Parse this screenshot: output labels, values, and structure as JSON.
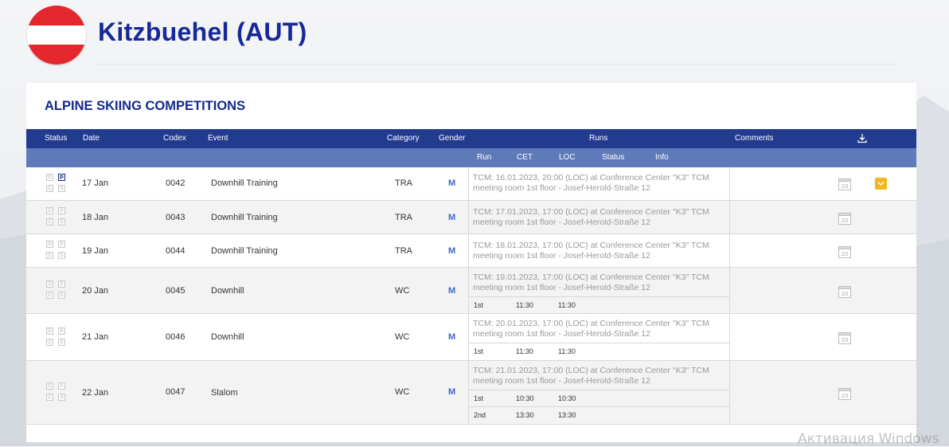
{
  "header": {
    "title": "Kitzbuehel (AUT)",
    "flag_colors": [
      "#e3272d",
      "#ffffff",
      "#e3272d"
    ]
  },
  "panel": {
    "title": "ALPINE SKIING COMPETITIONS"
  },
  "table": {
    "columns": {
      "status": "Status",
      "date": "Date",
      "codex": "Codex",
      "event": "Event",
      "category": "Category",
      "gender": "Gender",
      "runs": "Runs",
      "comments": "Comments"
    },
    "download_icon": "download-icon",
    "runs_subcolumns": {
      "run": "Run",
      "cet": "CET",
      "loc": "LOC",
      "status": "Status",
      "info": "Info"
    },
    "status_letters": [
      "D",
      "P",
      "C",
      "S"
    ],
    "rows": [
      {
        "date": "17 Jan",
        "codex": "0042",
        "event": "Downhill Training",
        "category": "TRA",
        "gender": "M",
        "tcm_line1": "TCM: 16.01.2023, 20:00 (LOC) at Conference Center \"K3\" TCM",
        "tcm_line2": "meeting room 1st floor - Josef-Herold-Straße 12",
        "runs": [],
        "calendar_label": "23",
        "has_info_button": true
      },
      {
        "date": "18 Jan",
        "codex": "0043",
        "event": "Downhill Training",
        "category": "TRA",
        "gender": "M",
        "tcm_line1": "TCM: 17.01.2023, 17:00 (LOC) at Conference Center \"K3\" TCM",
        "tcm_line2": "meeting room 1st floor - Josef-Herold-Straße 12",
        "runs": [],
        "calendar_label": "23",
        "has_info_button": false
      },
      {
        "date": "19 Jan",
        "codex": "0044",
        "event": "Downhill Training",
        "category": "TRA",
        "gender": "M",
        "tcm_line1": "TCM: 18.01.2023, 17:00 (LOC) at Conference Center \"K3\" TCM",
        "tcm_line2": "meeting room 1st floor - Josef-Herold-Straße 12",
        "runs": [],
        "calendar_label": "23",
        "has_info_button": false
      },
      {
        "date": "20 Jan",
        "codex": "0045",
        "event": "Downhill",
        "category": "WC",
        "gender": "M",
        "tcm_line1": "TCM: 19.01.2023, 17:00 (LOC) at Conference Center \"K3\" TCM",
        "tcm_line2": "meeting room 1st floor - Josef-Herold-Straße 12",
        "runs": [
          {
            "run": "1st",
            "cet": "11:30",
            "loc": "11:30"
          }
        ],
        "calendar_label": "23",
        "has_info_button": false
      },
      {
        "date": "21 Jan",
        "codex": "0046",
        "event": "Downhill",
        "category": "WC",
        "gender": "M",
        "tcm_line1": "TCM: 20.01.2023, 17:00 (LOC) at Conference Center \"K3\" TCM",
        "tcm_line2": "meeting room 1st floor - Josef-Herold-Straße 12",
        "runs": [
          {
            "run": "1st",
            "cet": "11:30",
            "loc": "11:30"
          }
        ],
        "calendar_label": "23",
        "has_info_button": false
      },
      {
        "date": "22 Jan",
        "codex": "0047",
        "event": "Slalom",
        "category": "WC",
        "gender": "M",
        "tcm_line1": "TCM: 21.01.2023, 17:00 (LOC) at Conference Center \"K3\" TCM",
        "tcm_line2": "meeting room 1st floor - Josef-Herold-Straße 12",
        "runs": [
          {
            "run": "1st",
            "cet": "10:30",
            "loc": "10:30"
          },
          {
            "run": "2nd",
            "cet": "13:30",
            "loc": "13:30"
          }
        ],
        "calendar_label": "23",
        "has_info_button": false
      }
    ]
  },
  "watermark": "Активация Windows",
  "colors": {
    "header_dark": "#233b8f",
    "header_light": "#5f7ab8",
    "title": "#16289a",
    "gender": "#3c64c8",
    "info_button": "#f5b521"
  }
}
